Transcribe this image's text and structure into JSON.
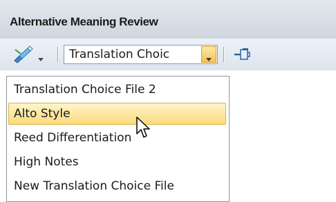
{
  "window": {
    "title": "Alternative Meaning Review"
  },
  "toolbar": {
    "tool_icon": "pen-brush-icon",
    "tool_dropdown_icon": "chevron-down-icon",
    "combo_value": "Translation Choic",
    "combo_arrow_icon": "chevron-down-icon",
    "pin_icon": "pin-icon"
  },
  "dropdown": {
    "items": [
      {
        "label": "Translation Choice File 2",
        "selected": false
      },
      {
        "label": "Alto Style",
        "selected": true
      },
      {
        "label": "Reed Differentiation",
        "selected": false
      },
      {
        "label": "High Notes",
        "selected": false
      },
      {
        "label": "New Translation Choice File",
        "selected": false
      }
    ]
  },
  "colors": {
    "highlight_top": "#fff5cc",
    "highlight_bottom": "#f9d97a",
    "accent_border": "#dcb44a"
  }
}
